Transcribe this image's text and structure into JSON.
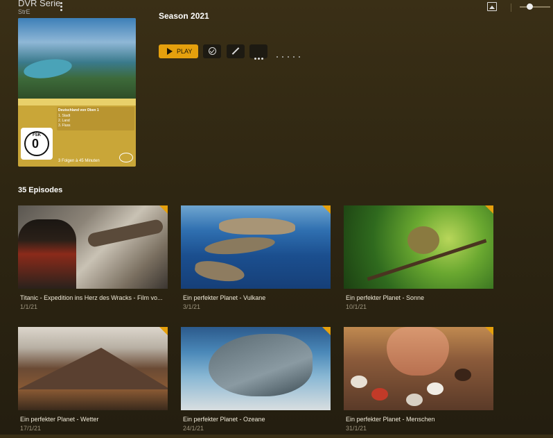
{
  "header": {
    "app_title": "DVR Serie",
    "app_subtitle": "StrE"
  },
  "show": {
    "season_label": "Season 2021",
    "poster": {
      "info_title": "Deutschland von Oben 1",
      "info_items": [
        "1. Stadt",
        "2. Land",
        "3. Fluss"
      ],
      "footer_text": "3 Folgen à 45 Minuten",
      "rating_label": "FSK",
      "rating_value": "0"
    }
  },
  "actions": {
    "play_label": "PLAY"
  },
  "episodes_heading": "35 Episodes",
  "episodes": [
    {
      "title": "Titanic - Expedition ins Herz des Wracks - Film vo...",
      "date": "1/1/21"
    },
    {
      "title": "Ein perfekter Planet - Vulkane",
      "date": "3/1/21"
    },
    {
      "title": "Ein perfekter Planet - Sonne",
      "date": "10/1/21"
    },
    {
      "title": "Ein perfekter Planet - Wetter",
      "date": "17/1/21"
    },
    {
      "title": "Ein perfekter Planet - Ozeane",
      "date": "24/1/21"
    },
    {
      "title": "Ein perfekter Planet - Menschen",
      "date": "31/1/21"
    }
  ],
  "icons": {
    "menu": "more-vertical-icon",
    "image": "image-icon",
    "play": "play-icon",
    "watched": "check-circle-icon",
    "edit": "pencil-icon",
    "more": "more-horizontal-icon"
  },
  "colors": {
    "accent": "#e5a00d",
    "background": "#2e2612"
  }
}
